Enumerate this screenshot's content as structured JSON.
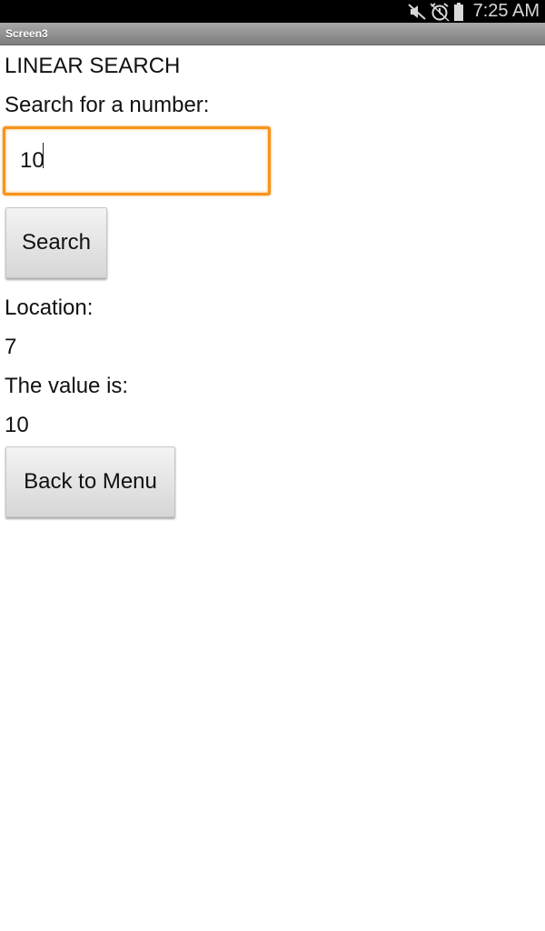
{
  "status_bar": {
    "time": "7:25 AM",
    "icons": [
      "mute-icon",
      "alarm-icon",
      "battery-icon"
    ]
  },
  "title_bar": {
    "title": "Screen3"
  },
  "main": {
    "heading": "LINEAR SEARCH",
    "search_prompt": "Search for a number:",
    "search_input_value": "10",
    "search_button_label": "Search",
    "location_label": "Location:",
    "location_value": "7",
    "value_label": "The value is:",
    "value_value": "10",
    "back_button_label": "Back to Menu"
  },
  "colors": {
    "status_bar": "#000000",
    "title_bar": "#8f8f8f",
    "input_focus_border": "#f7941d",
    "background": "#ffffff"
  }
}
